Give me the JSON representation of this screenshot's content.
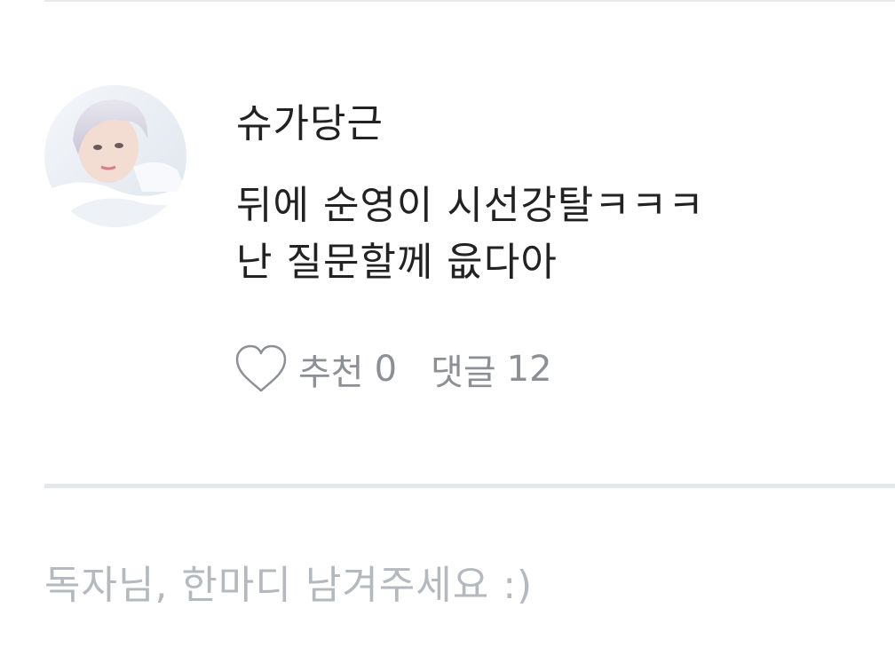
{
  "comment": {
    "author": "슈가당근",
    "text_lines": [
      "뒤에 순영이 시선강탈ㅋㅋㅋ",
      "난 질문할께 읎다아"
    ],
    "like_label": "추천",
    "like_count": "0",
    "reply_label": "댓글",
    "reply_count": "12",
    "icons": {
      "like": "heart-outline-icon"
    }
  },
  "reply_input": {
    "placeholder": "독자님, 한마디 남겨주세요 :)",
    "value": ""
  },
  "colors": {
    "text": "#222222",
    "muted": "#8c8f94",
    "placeholder": "#b3b9bf",
    "divider": "#e4e7ea"
  }
}
